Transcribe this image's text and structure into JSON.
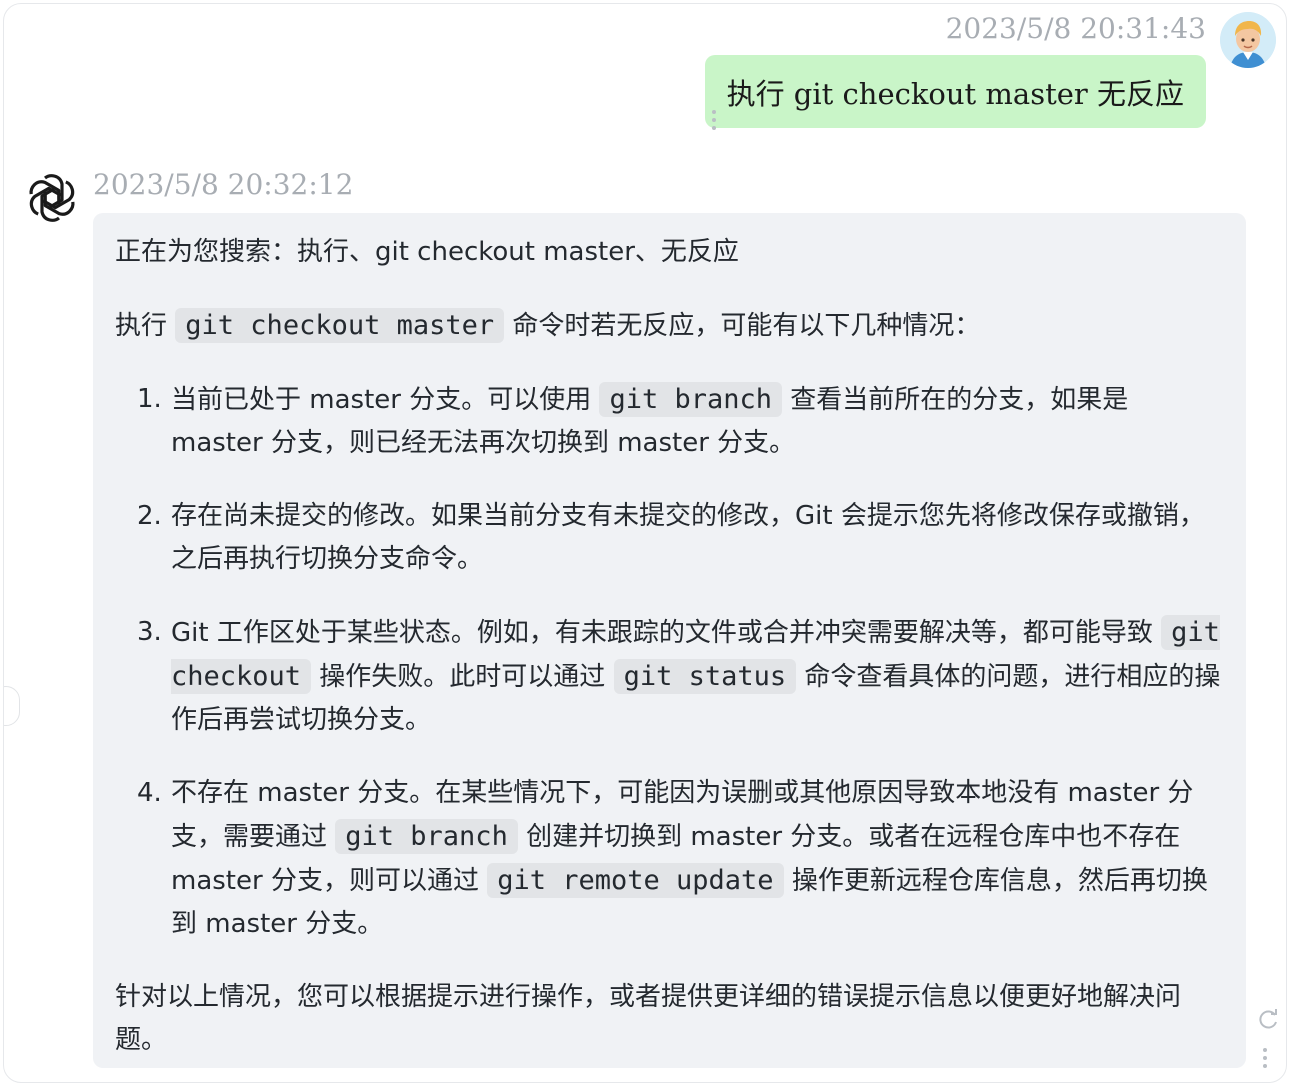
{
  "user_message": {
    "timestamp": "2023/5/8 20:31:43",
    "text": "执行  git checkout master 无反应"
  },
  "assistant_message": {
    "timestamp": "2023/5/8 20:32:12",
    "search_line": "正在为您搜索：执行、git checkout master、无反应",
    "intro": {
      "before": "执行",
      "code": "git checkout master",
      "after": "命令时若无反应，可能有以下几种情况："
    },
    "items": [
      {
        "num": "1.",
        "segments": [
          {
            "t": "text",
            "v": "当前已处于 master 分支。可以使用 "
          },
          {
            "t": "code",
            "v": "git branch"
          },
          {
            "t": "text",
            "v": " 查看当前所在的分支，如果是 master 分支，则已经无法再次切换到 master 分支。"
          }
        ]
      },
      {
        "num": "2.",
        "segments": [
          {
            "t": "text",
            "v": "存在尚未提交的修改。如果当前分支有未提交的修改，Git 会提示您先将修改保存或撤销，之后再执行切换分支命令。"
          }
        ]
      },
      {
        "num": "3.",
        "segments": [
          {
            "t": "text",
            "v": "Git 工作区处于某些状态。例如，有未跟踪的文件或合并冲突需要解决等，都可能导致 "
          },
          {
            "t": "code",
            "v": "git checkout"
          },
          {
            "t": "text",
            "v": " 操作失败。此时可以通过 "
          },
          {
            "t": "code",
            "v": "git status"
          },
          {
            "t": "text",
            "v": " 命令查看具体的问题，进行相应的操作后再尝试切换分支。"
          }
        ]
      },
      {
        "num": "4.",
        "segments": [
          {
            "t": "text",
            "v": "不存在 master 分支。在某些情况下，可能因为误删或其他原因导致本地没有 master 分支，需要通过 "
          },
          {
            "t": "code",
            "v": "git branch"
          },
          {
            "t": "text",
            "v": " 创建并切换到 master 分支。或者在远程仓库中也不存在 master 分支，则可以通过 "
          },
          {
            "t": "code",
            "v": "git remote update"
          },
          {
            "t": "text",
            "v": " 操作更新远程仓库信息，然后再切换到 master 分支。"
          }
        ]
      }
    ],
    "conclusion": "针对以上情况，您可以根据提示进行操作，或者提供更详细的错误提示信息以便更好地解决问题。"
  },
  "icons": {
    "user_avatar": "user-avatar-icon",
    "assistant_logo": "openai-logo-icon",
    "more_menu": "more-vertical-icon",
    "refresh": "refresh-icon"
  },
  "colors": {
    "user_bubble": "#c9f5c8",
    "assistant_bubble": "#f0f2f5",
    "timestamp": "#a8adb3",
    "code_bg": "#e2e4e7"
  }
}
